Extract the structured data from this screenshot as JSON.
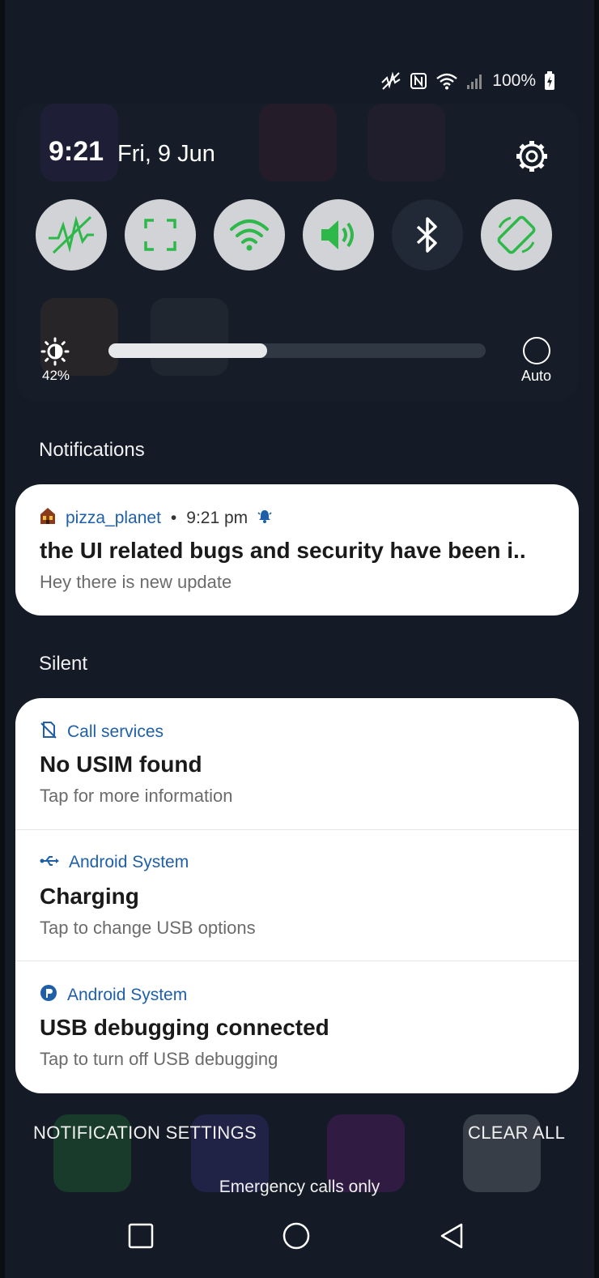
{
  "status_bar": {
    "battery": "100%"
  },
  "quick_settings": {
    "time": "9:21",
    "date": "Fri, 9 Jun",
    "tiles": [
      {
        "name": "mobile-data-off",
        "state": "on"
      },
      {
        "name": "screenshot-capture",
        "state": "on"
      },
      {
        "name": "wifi",
        "state": "on"
      },
      {
        "name": "sound",
        "state": "on"
      },
      {
        "name": "bluetooth",
        "state": "off"
      },
      {
        "name": "auto-rotate",
        "state": "on"
      }
    ],
    "brightness_percent": "42%",
    "brightness_level": 0.42,
    "auto_label": "Auto"
  },
  "sections": {
    "notifications": "Notifications",
    "silent": "Silent"
  },
  "notifications": [
    {
      "app": "pizza_planet",
      "time": "9:21 pm",
      "title": "the UI related bugs and security have been i..",
      "text": "Hey there is new update"
    }
  ],
  "silent_notifications": [
    {
      "app": "Call services",
      "title": "No USIM found",
      "text": "Tap for more information"
    },
    {
      "app": "Android System",
      "title": "Charging",
      "text": "Tap to change USB options"
    },
    {
      "app": "Android System",
      "title": "USB debugging connected",
      "text": "Tap to turn off USB debugging"
    }
  ],
  "footer": {
    "notification_settings": "NOTIFICATION SETTINGS",
    "clear_all": "CLEAR ALL",
    "emergency": "Emergency calls only"
  },
  "colors": {
    "accent_green": "#2fb84a",
    "link_blue": "#1f5fa8",
    "shade_bg": "#141b26"
  }
}
